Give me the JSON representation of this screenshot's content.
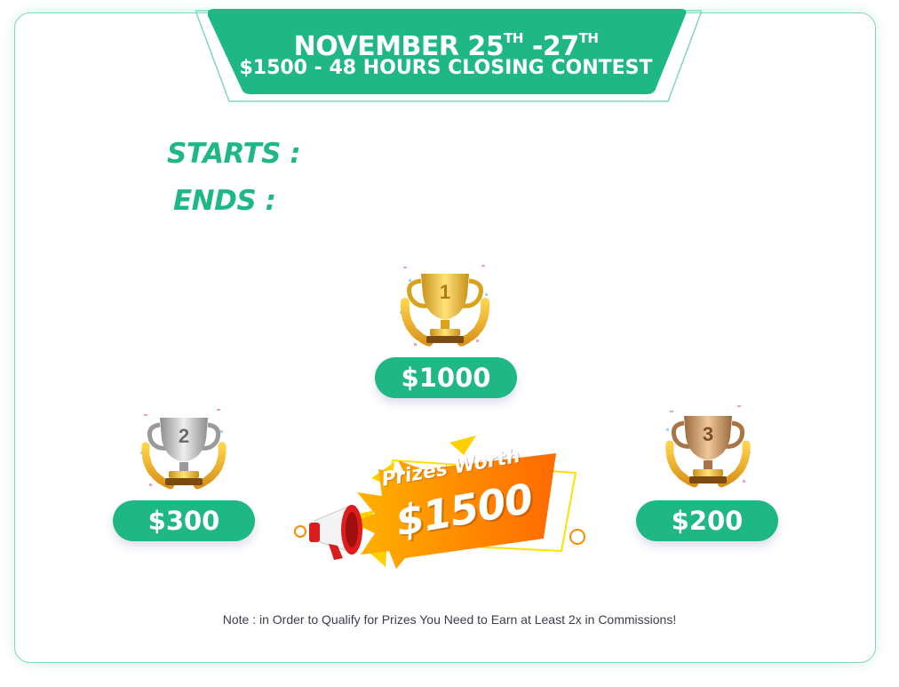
{
  "banner": {
    "month": "NOVEMBER 25",
    "start_suffix": "TH",
    "dash": "-",
    "end_day": "27",
    "end_suffix": "TH",
    "subtitle": "$1500 - 48 HOURS CLOSING CONTEST"
  },
  "schedule": {
    "starts_label": "STARTS :",
    "ends_label": "ENDS :"
  },
  "prizes": [
    {
      "rank": "1",
      "amount": "$1000",
      "trophy": "gold-trophy-icon"
    },
    {
      "rank": "2",
      "amount": "$300",
      "trophy": "silver-trophy-icon"
    },
    {
      "rank": "3",
      "amount": "$200",
      "trophy": "bronze-trophy-icon"
    }
  ],
  "promo": {
    "line1": "Prizes Worth",
    "line2": "$1500",
    "icon": "megaphone-icon"
  },
  "note": "Note : in Order to Qualify for Prizes You Need to Earn at Least 2x in Commissions!",
  "colors": {
    "accent": "#1fb884",
    "gold": "#e8b923",
    "silver": "#b8b8b8",
    "bronze": "#c08a5a",
    "orange": "#ff7a00",
    "yellow": "#ffcc00"
  }
}
